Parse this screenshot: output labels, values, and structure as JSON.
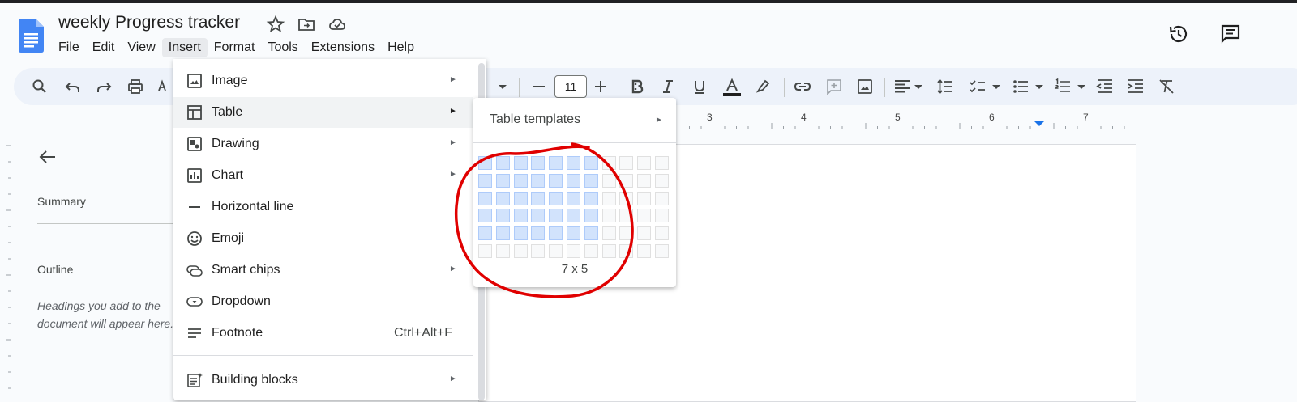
{
  "document": {
    "title": "weekly Progress tracker"
  },
  "menubar": {
    "items": [
      "File",
      "Edit",
      "View",
      "Insert",
      "Format",
      "Tools",
      "Extensions",
      "Help"
    ],
    "active": "Insert"
  },
  "toolbar": {
    "font_size": "11"
  },
  "ruler": {
    "numbers": [
      "3",
      "4",
      "5",
      "6",
      "7"
    ]
  },
  "sidebar": {
    "summary_label": "Summary",
    "outline_label": "Outline",
    "outline_hint": "Headings you add to the document will appear here."
  },
  "insert_menu": {
    "items": [
      {
        "label": "Image",
        "icon": "image-icon",
        "has_submenu": true
      },
      {
        "label": "Table",
        "icon": "table-icon",
        "has_submenu": true
      },
      {
        "label": "Drawing",
        "icon": "drawing-icon",
        "has_submenu": true
      },
      {
        "label": "Chart",
        "icon": "chart-icon",
        "has_submenu": true
      },
      {
        "label": "Horizontal line",
        "icon": "horizontal-line-icon",
        "has_submenu": false
      },
      {
        "label": "Emoji",
        "icon": "emoji-icon",
        "has_submenu": false
      },
      {
        "label": "Smart chips",
        "icon": "smart-chips-icon",
        "has_submenu": true
      },
      {
        "label": "Dropdown",
        "icon": "dropdown-icon",
        "has_submenu": false
      },
      {
        "label": "Footnote",
        "icon": "footnote-icon",
        "has_submenu": false,
        "shortcut": "Ctrl+Alt+F"
      },
      {
        "label": "Building blocks",
        "icon": "building-blocks-icon",
        "has_submenu": true
      }
    ]
  },
  "table_submenu": {
    "templates_label": "Table templates",
    "grid_columns": 11,
    "grid_rows": 6,
    "selected_columns": 7,
    "selected_rows": 5,
    "size_label": "7 x 5"
  },
  "colors": {
    "accent": "#1a73e8",
    "selection": "#d2e3fc",
    "annotation": "#e00000"
  }
}
